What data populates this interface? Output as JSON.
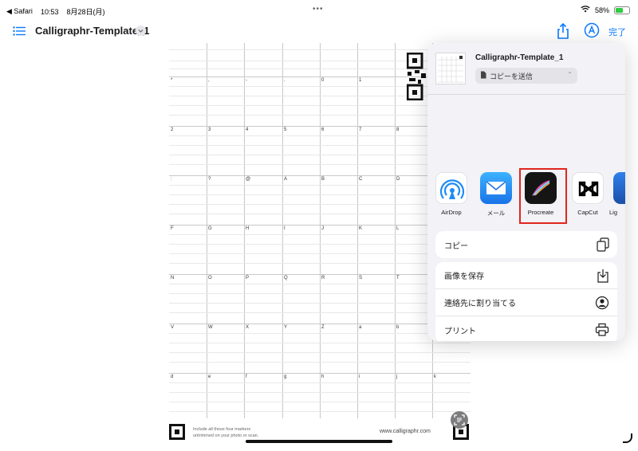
{
  "status": {
    "back_app": "◀ Safari",
    "time": "10:53",
    "date": "8月28日(月)",
    "battery": "58%",
    "battery_level": 0.58
  },
  "toolbar": {
    "title": "Calligraphr-Template_1",
    "done_label": "完了"
  },
  "template": {
    "rows": [
      [
        "*",
        ",",
        "-",
        ".",
        "0",
        "1"
      ],
      [
        "2",
        "3",
        "4",
        "5",
        "6",
        "7",
        "8"
      ],
      [
        ":",
        "?",
        "@",
        "A",
        "B",
        "C",
        "D"
      ],
      [
        "F",
        "G",
        "H",
        "I",
        "J",
        "K",
        "L"
      ],
      [
        "N",
        "O",
        "P",
        "Q",
        "R",
        "S",
        "T"
      ],
      [
        "V",
        "W",
        "X",
        "Y",
        "Z",
        "a",
        "b"
      ],
      [
        "d",
        "e",
        "f",
        "g",
        "h",
        "i",
        "j",
        "k"
      ]
    ],
    "footer_line1": "Include all those four markers",
    "footer_line2": "untrimmed on your photo or scan.",
    "url": "www.calligraphr.com"
  },
  "share_sheet": {
    "file_name": "Calligraphr-Template_1",
    "send_option": "コピーを送信",
    "apps": [
      {
        "label": "AirDrop",
        "icon": "airdrop-icon"
      },
      {
        "label": "メール",
        "icon": "mail-icon"
      },
      {
        "label": "Procreate",
        "icon": "procreate-icon"
      },
      {
        "label": "CapCut",
        "icon": "capcut-icon"
      },
      {
        "label": "Lig",
        "icon": "app-icon"
      }
    ],
    "actions": [
      {
        "label": "コピー",
        "icon": "copy-icon"
      },
      {
        "label": "画像を保存",
        "icon": "save-image-icon"
      },
      {
        "label": "連絡先に割り当てる",
        "icon": "contact-icon"
      },
      {
        "label": "プリント",
        "icon": "print-icon"
      }
    ]
  },
  "colors": {
    "accent": "#0a7aff",
    "highlight": "#e0261e",
    "sheet_bg": "#f2f2f7"
  }
}
